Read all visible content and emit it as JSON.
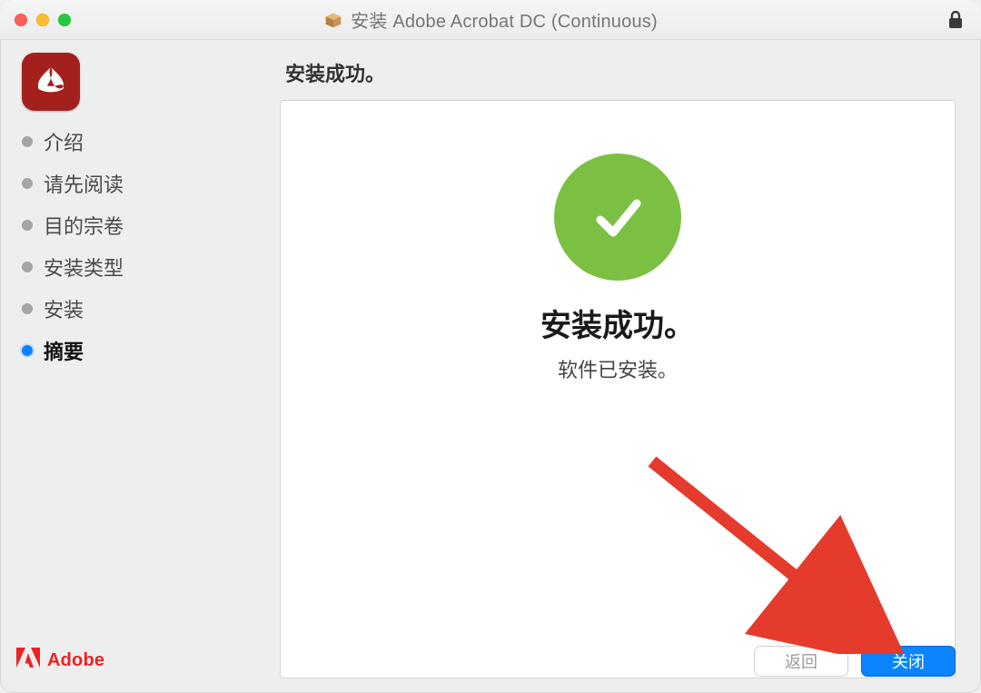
{
  "window": {
    "title": "安装 Adobe Acrobat DC (Continuous)"
  },
  "sidebar": {
    "steps": [
      {
        "label": "介绍",
        "current": false
      },
      {
        "label": "请先阅读",
        "current": false
      },
      {
        "label": "目的宗卷",
        "current": false
      },
      {
        "label": "安装类型",
        "current": false
      },
      {
        "label": "安装",
        "current": false
      },
      {
        "label": "摘要",
        "current": true
      }
    ],
    "brand": "Adobe"
  },
  "main": {
    "heading": "安装成功。",
    "success_title": "安装成功。",
    "success_subtitle": "软件已安装。"
  },
  "footer": {
    "back_label": "返回",
    "close_label": "关闭"
  },
  "colors": {
    "accent": "#0a84ff",
    "success": "#7bc043",
    "brand_red": "#ed2224",
    "acrobat_red": "#a4201d"
  }
}
